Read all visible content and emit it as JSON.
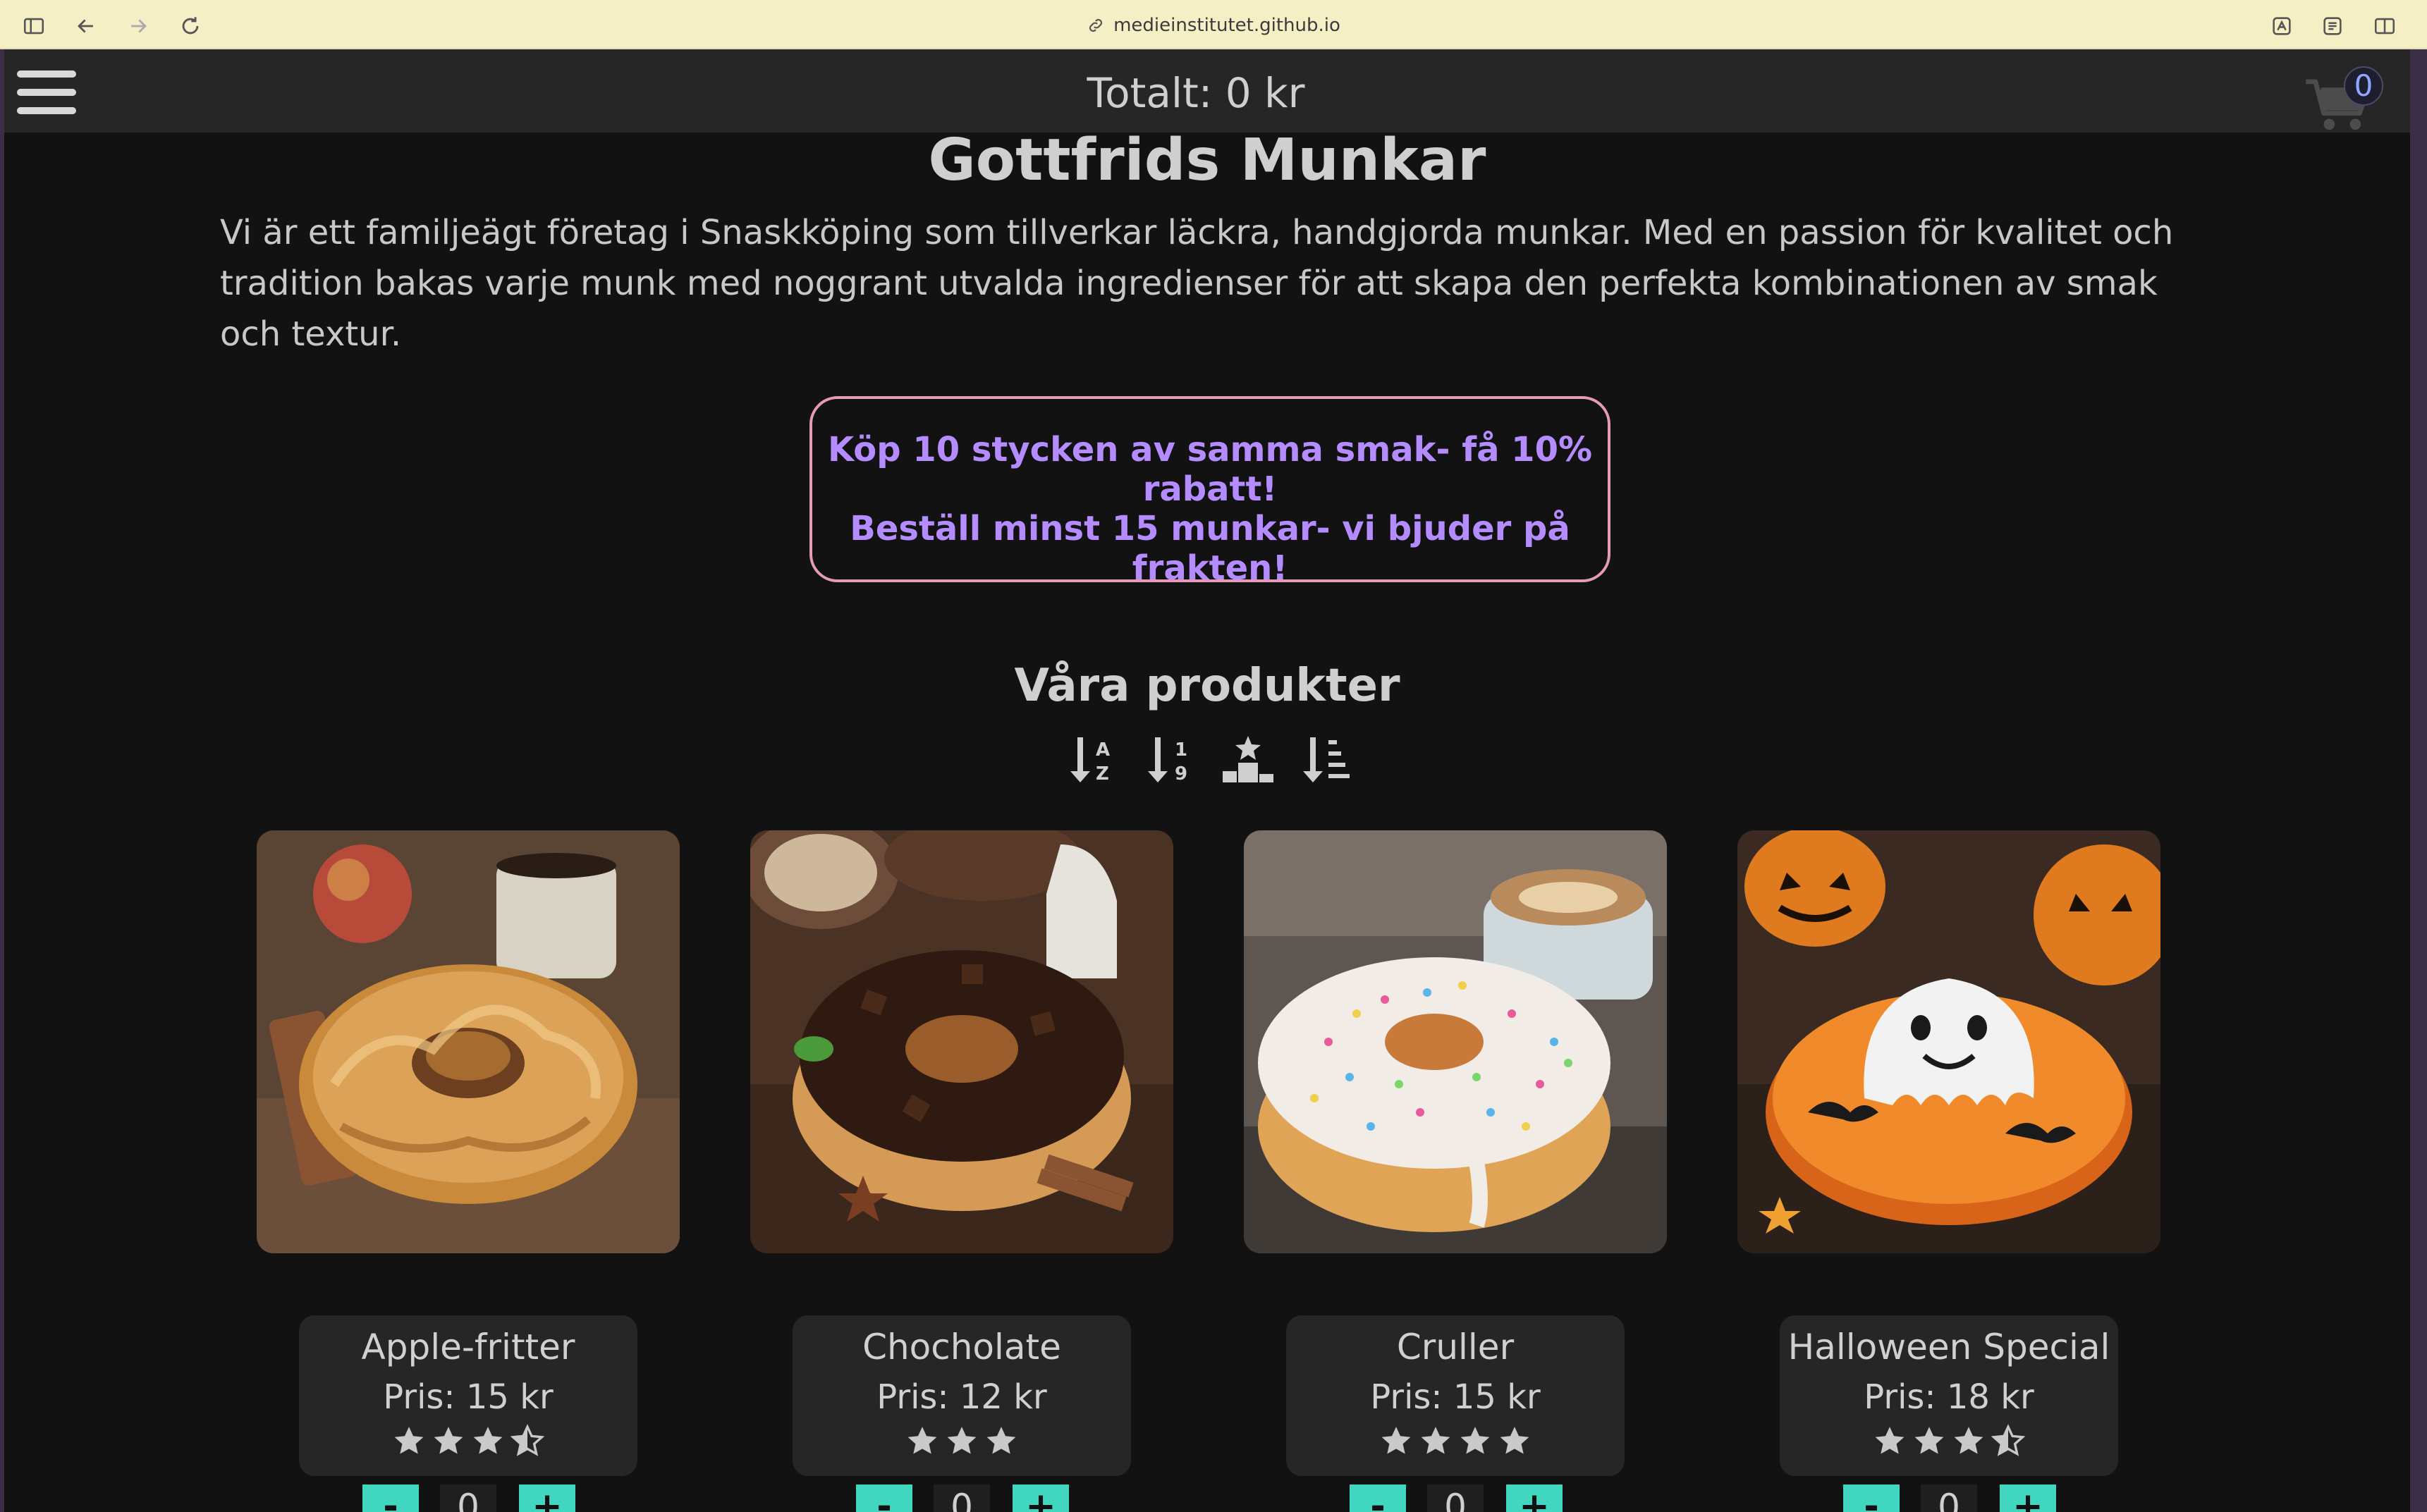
{
  "browser": {
    "url": "medieinstitutet.github.io",
    "icons": [
      "sidebar-icon",
      "back-icon",
      "forward-icon",
      "reload-icon",
      "link-icon",
      "translate-icon",
      "reader-icon",
      "split-view-icon"
    ]
  },
  "header": {
    "total_label": "Totalt: 0 kr",
    "cart_count": "0",
    "menu_icon": "hamburger-icon",
    "cart_icon": "cart-icon"
  },
  "main": {
    "title": "Gottfrids Munkar",
    "intro": "Vi är ett familjeägt företag i Snaskköping som tillverkar läckra, handgjorda munkar. Med en passion för kvalitet och tradition bakas varje munk med noggrant utvalda ingredienser för att skapa den perfekta kombinationen av smak och textur.",
    "promo": {
      "line1": "Köp 10 stycken av samma smak- få 10% rabatt!",
      "line2": "Beställ minst 15 munkar- vi bjuder på frakten!"
    },
    "products_heading": "Våra produkter",
    "sort_icons": [
      "sort-alpha-icon",
      "sort-numeric-icon",
      "sort-rating-icon",
      "sort-category-icon"
    ]
  },
  "products": [
    {
      "name": "Apple-fritter",
      "price": "Pris: 15 kr",
      "rating": 3.5,
      "qty": "0",
      "minus": "-",
      "plus": "+"
    },
    {
      "name": "Chocholate",
      "price": "Pris: 12 kr",
      "rating": 3,
      "qty": "0",
      "minus": "-",
      "plus": "+"
    },
    {
      "name": "Cruller",
      "price": "Pris: 15 kr",
      "rating": 4,
      "qty": "0",
      "minus": "-",
      "plus": "+"
    },
    {
      "name": "Halloween Special",
      "price": "Pris: 18 kr",
      "rating": 3.5,
      "qty": "0",
      "minus": "-",
      "plus": "+"
    }
  ],
  "colors": {
    "accent": "#41d6c0",
    "promo_text": "#b58cff",
    "promo_border": "#e59bb7",
    "background": "#121212"
  }
}
